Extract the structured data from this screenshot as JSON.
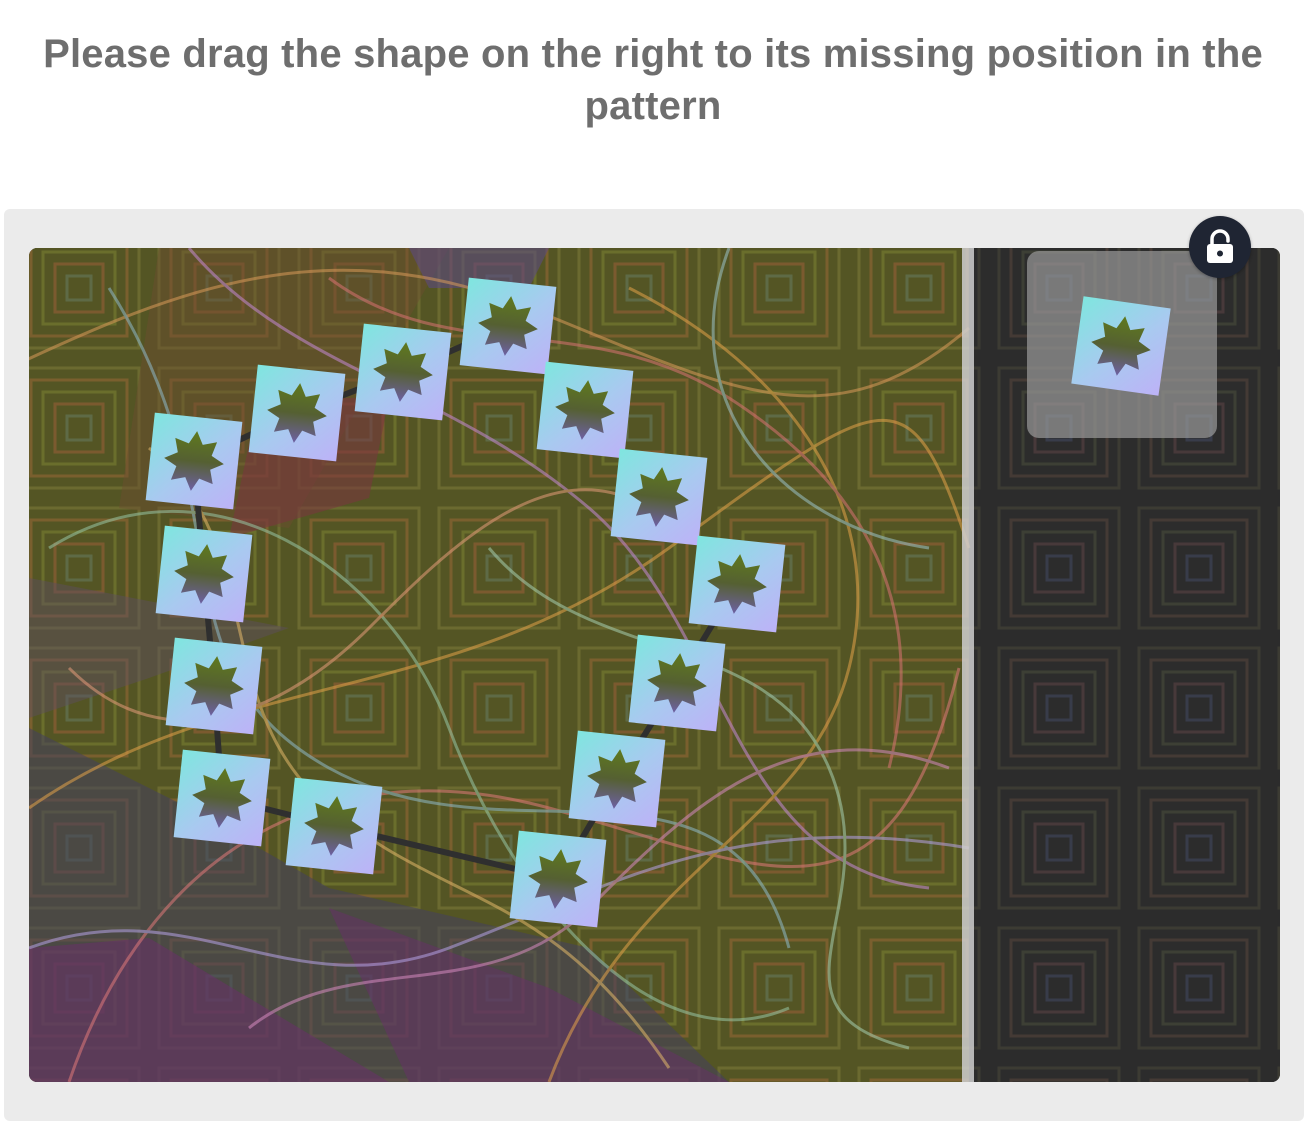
{
  "instruction": {
    "line1": "Please drag the shape on the right to its missing position in the",
    "line2": "pattern"
  },
  "icons": {
    "lock": "lock-icon",
    "piece_shape": "eight-point-star-icon"
  },
  "colors": {
    "title_text": "#6e6e6e",
    "frame_bg": "#ebebeb",
    "puzzle_olive": "#5a5a2a",
    "puzzle_dark": "#2d2d2d",
    "tile_cyan": "#7fe3e0",
    "tile_lavender": "#b7b3f5",
    "star_olive": "#5b6b22",
    "star_purple": "#6a5f9a",
    "lock_button_bg": "#1f2533",
    "drag_piece_frame": "#8f8f8f",
    "chain_line": "#2f2f2f"
  }
}
